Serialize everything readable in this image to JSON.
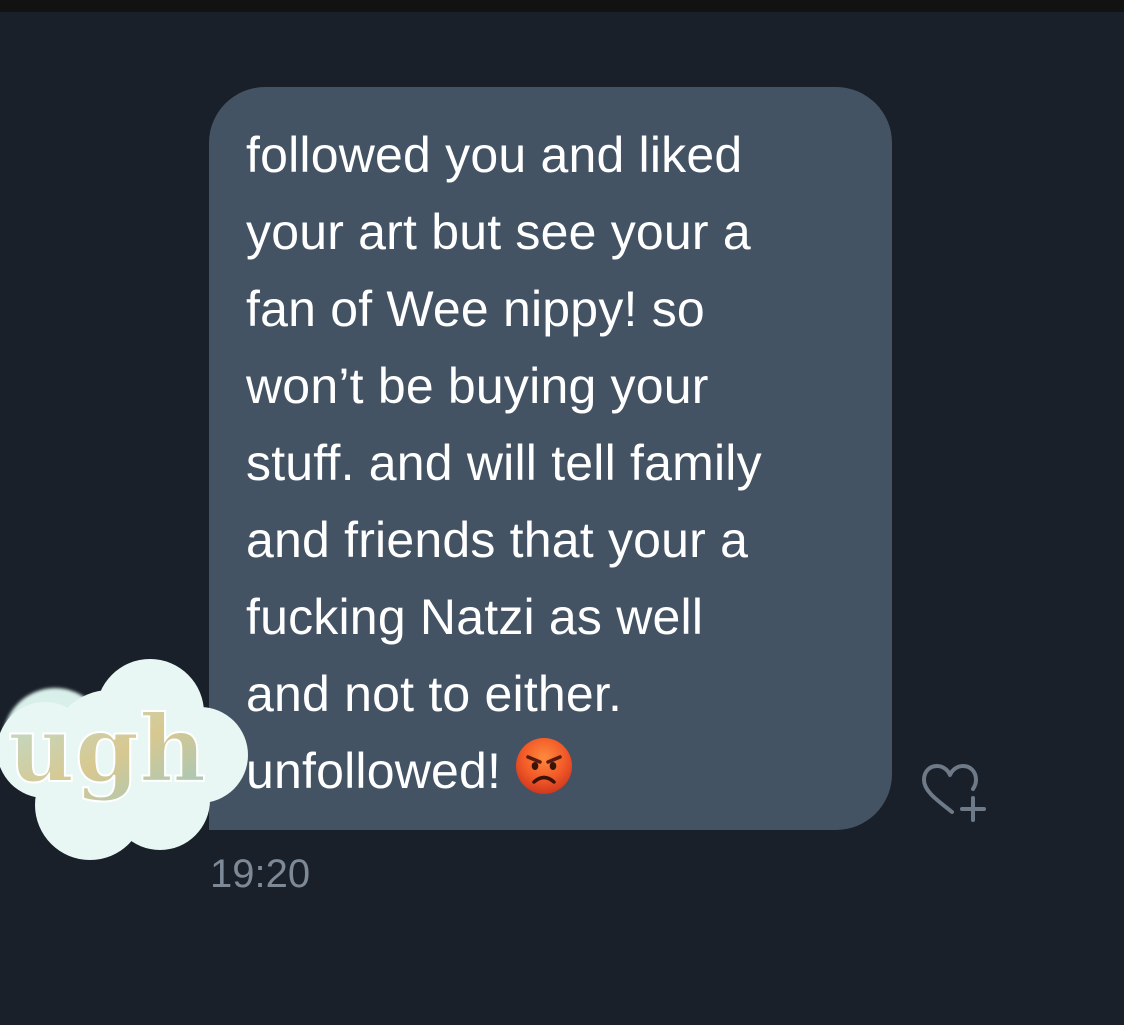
{
  "conversation": {
    "message": {
      "lines": [
        "followed you and liked",
        "your art but see your a",
        "fan of Wee nippy! so",
        "won’t be buying your",
        "stuff. and will tell family",
        "and friends that your a",
        "fucking Natzi as well",
        "and not to either.",
        "unfollowed!"
      ],
      "emoji": "angry-face-emoji",
      "timestamp": "19:20",
      "bubble_color": "#435364"
    },
    "reaction_button": {
      "icon": "heart-plus-icon"
    }
  },
  "sticker": {
    "text": "ugh",
    "cloud_color": "#e8f7f4",
    "letter_gradient": [
      "#b9ded6",
      "#d8c890",
      "#9bc7c0"
    ]
  },
  "colors": {
    "background": "#19202a",
    "text": "#ffffff",
    "timestamp": "#7d8997",
    "icon": "#6e7a88"
  }
}
